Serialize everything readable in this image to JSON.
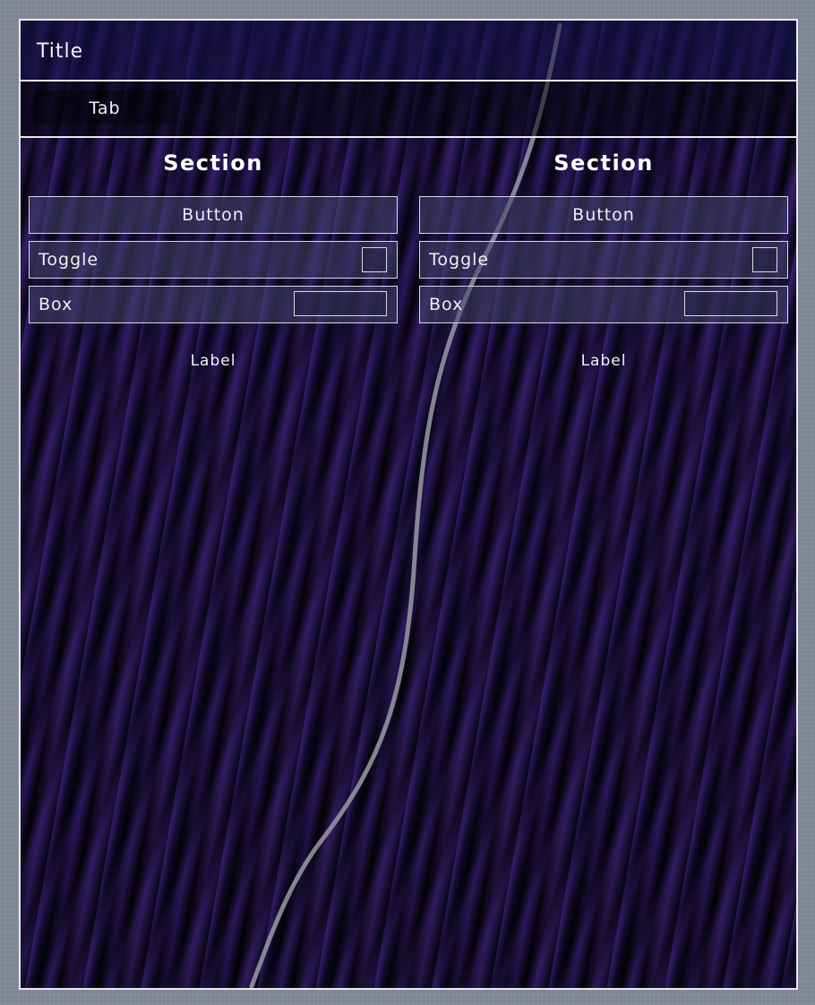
{
  "window": {
    "title": "Title"
  },
  "tabs": [
    {
      "label": "Tab"
    }
  ],
  "columns": [
    {
      "section_title": "Section",
      "button_label": "Button",
      "toggle_label": "Toggle",
      "toggle_checked": false,
      "box_label": "Box",
      "box_value": "",
      "label_text": "Label"
    },
    {
      "section_title": "Section",
      "button_label": "Button",
      "toggle_label": "Toggle",
      "toggle_checked": false,
      "box_label": "Box",
      "box_value": "",
      "label_text": "Label"
    }
  ],
  "colors": {
    "border": "#e8e8ee",
    "background": "#7e8594",
    "panel_tint": "#150e3a",
    "accent_purple": "#6a3aa8"
  }
}
